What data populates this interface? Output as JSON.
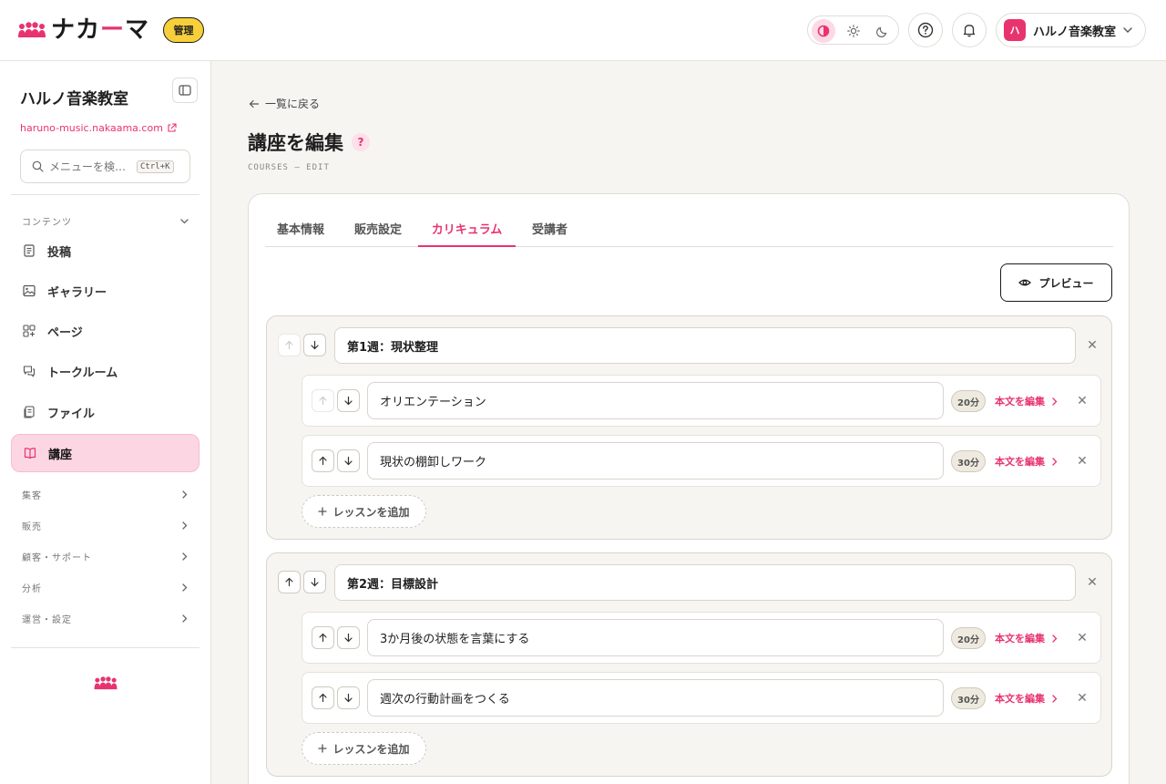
{
  "header": {
    "logo_text": "ナカ",
    "logo_dash": "ー",
    "logo_text_end": "マ",
    "admin_badge": "管理",
    "account_avatar": "ハ",
    "account_name": "ハルノ音楽教室"
  },
  "sidebar": {
    "org_name": "ハルノ音楽教室",
    "site_url": "haruno-music.nakaama.com",
    "search_placeholder": "メニューを検…",
    "search_shortcut": "Ctrl+K",
    "content_group": "コンテンツ",
    "items": [
      {
        "label": "投稿",
        "icon": "document-icon"
      },
      {
        "label": "ギャラリー",
        "icon": "image-icon"
      },
      {
        "label": "ページ",
        "icon": "pages-icon"
      },
      {
        "label": "トークルーム",
        "icon": "chat-icon"
      },
      {
        "label": "ファイル",
        "icon": "file-icon"
      },
      {
        "label": "講座",
        "icon": "book-icon",
        "active": true
      }
    ],
    "groups": [
      "集客",
      "販売",
      "顧客・サポート",
      "分析",
      "運営・設定"
    ]
  },
  "main": {
    "back_label": "一覧に戻る",
    "title": "講座を編集",
    "help": "?",
    "subtitle": "COURSES — EDIT",
    "tabs": [
      "基本情報",
      "販売設定",
      "カリキュラム",
      "受講者"
    ],
    "active_tab": "カリキュラム",
    "preview_label": "プレビュー",
    "edit_body_label": "本文を編集",
    "add_lesson_label": "レッスンを追加",
    "sections": [
      {
        "title": "第1週：現状整理",
        "lessons": [
          {
            "title": "オリエンテーション",
            "duration": "20分"
          },
          {
            "title": "現状の棚卸しワーク",
            "duration": "30分"
          }
        ]
      },
      {
        "title": "第2週：目標設計",
        "lessons": [
          {
            "title": "3か月後の状態を言葉にする",
            "duration": "20分"
          },
          {
            "title": "週次の行動計画をつくる",
            "duration": "30分"
          }
        ]
      }
    ]
  },
  "colors": {
    "accent": "#e8336f",
    "badge": "#f7cf3a",
    "active_bg": "#fdd6e3"
  }
}
